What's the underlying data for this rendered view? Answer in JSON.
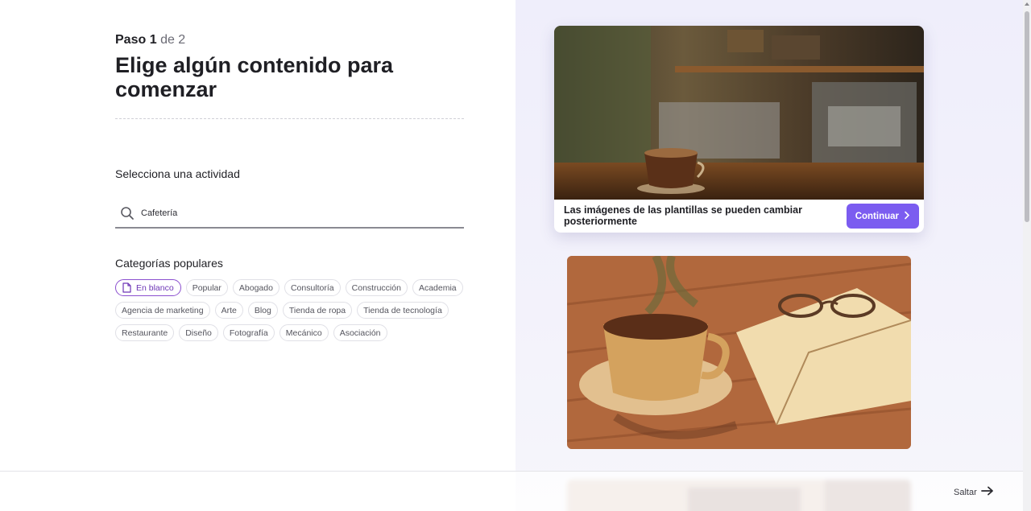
{
  "header": {
    "step_word": "Paso",
    "step_number": "1",
    "step_total": "de 2",
    "title": "Elige algún contenido para comenzar"
  },
  "activity": {
    "label": "Selecciona una actividad",
    "search_value": "Cafetería",
    "search_icon": "search-icon"
  },
  "categories": {
    "label": "Categorías populares",
    "rows": [
      [
        "En blanco",
        "Popular",
        "Abogado",
        "Consultoría",
        "Construcción",
        "Academia"
      ],
      [
        "Agencia de marketing",
        "Arte",
        "Blog",
        "Tienda de ropa",
        "Tienda de tecnología"
      ],
      [
        "Restaurante",
        "Diseño",
        "Fotografía",
        "Mecánico",
        "Asociación"
      ]
    ],
    "selected": "En blanco"
  },
  "preview": {
    "caption": "Las imágenes de las plantillas se pueden cambiar posteriormente",
    "continue_label": "Continuar"
  },
  "footer": {
    "skip_label": "Saltar"
  },
  "colors": {
    "accent": "#7b5cf0",
    "chip_selected_border": "#8b4fcf",
    "right_pane_bg": "#efeefb"
  }
}
